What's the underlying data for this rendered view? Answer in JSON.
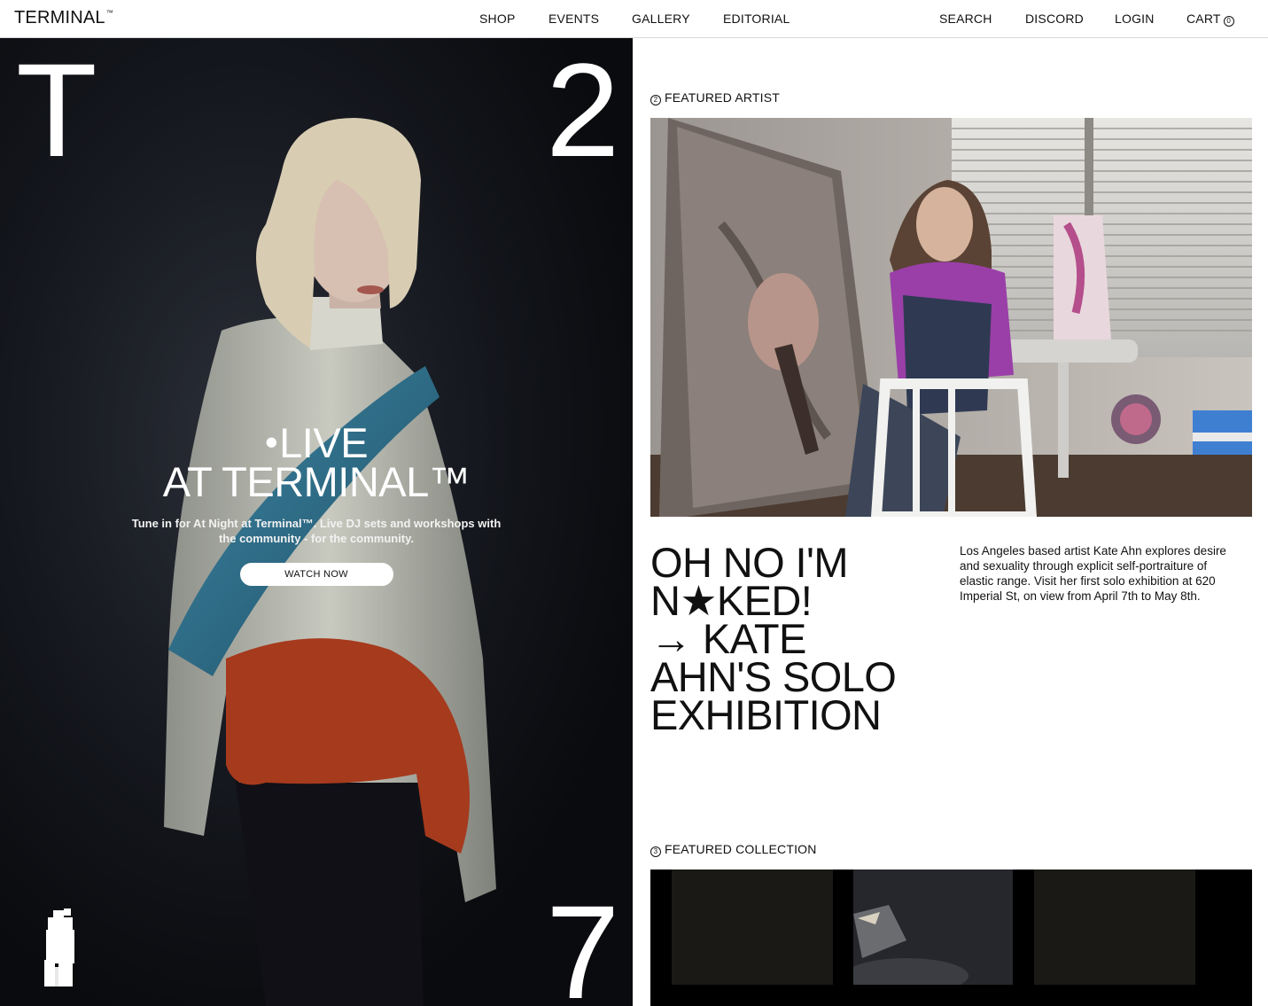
{
  "nav": {
    "logo": "TERMINAL",
    "logo_tm": "™",
    "links": [
      "SHOP",
      "EVENTS",
      "GALLERY",
      "EDITORIAL"
    ],
    "search": "SEARCH",
    "discord": "DISCORD",
    "login": "LOGIN",
    "cart": "CART",
    "cart_count": "0"
  },
  "hero": {
    "corner_top_left": "T",
    "corner_top_right": "2",
    "corner_bottom_right": "7",
    "live_dot": "•",
    "title_line1": "LIVE",
    "title_line2": "AT TERMINAL™",
    "subtitle": "Tune in for At Night at Terminal™. Live DJ sets and workshops with the community - for the community.",
    "button": "WATCH NOW"
  },
  "featured_artist": {
    "number": "2",
    "label": "FEATURED ARTIST",
    "headline": [
      "OH NO I'M",
      "N★KED!",
      "→ KATE",
      "AHN'S SOLO",
      "EXHIBITION"
    ],
    "description": "Los Angeles based artist Kate Ahn explores desire and sexuality through explicit self-portraiture of elastic range. Visit her first solo exhibition at 620 Imperial St, on view from April 7th to May 8th."
  },
  "featured_collection": {
    "number": "3",
    "label": "FEATURED COLLECTION"
  },
  "colors": {
    "hero_bg": "#0d0f14",
    "text": "#111111",
    "white": "#ffffff",
    "divider": "#d9d9d9"
  }
}
